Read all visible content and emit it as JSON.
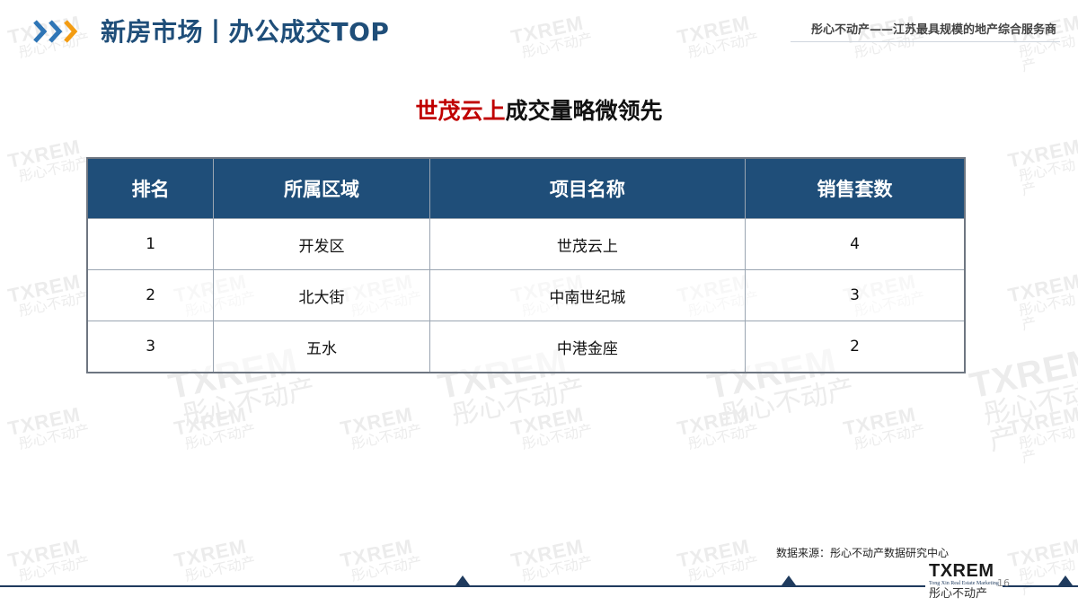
{
  "header": {
    "title": "新房市场丨办公成交TOP",
    "tagline": "彤心不动产——江苏最具规模的地产综合服务商"
  },
  "heading": {
    "highlight": "世茂云上",
    "rest": "成交量略微领先"
  },
  "table": {
    "headers": [
      "排名",
      "所属区域",
      "项目名称",
      "销售套数"
    ],
    "rows": [
      [
        "1",
        "开发区",
        "世茂云上",
        "4"
      ],
      [
        "2",
        "北大街",
        "中南世纪城",
        "3"
      ],
      [
        "3",
        "五水",
        "中港金座",
        "2"
      ]
    ]
  },
  "footer": {
    "source": "数据来源：彤心不动产数据研究中心",
    "logo_mark": "TXREM",
    "logo_en": "Tong Xin Real Estate Marketing",
    "logo_cn": "彤心不动产",
    "page_number": "16"
  },
  "watermark": {
    "brand": "TXREM",
    "brand_cn": "彤心不动产"
  },
  "colors": {
    "primary": "#1f4e79",
    "accent_red": "#c00000",
    "chevron_blue": "#2e75b6",
    "chevron_orange": "#f39c12"
  }
}
